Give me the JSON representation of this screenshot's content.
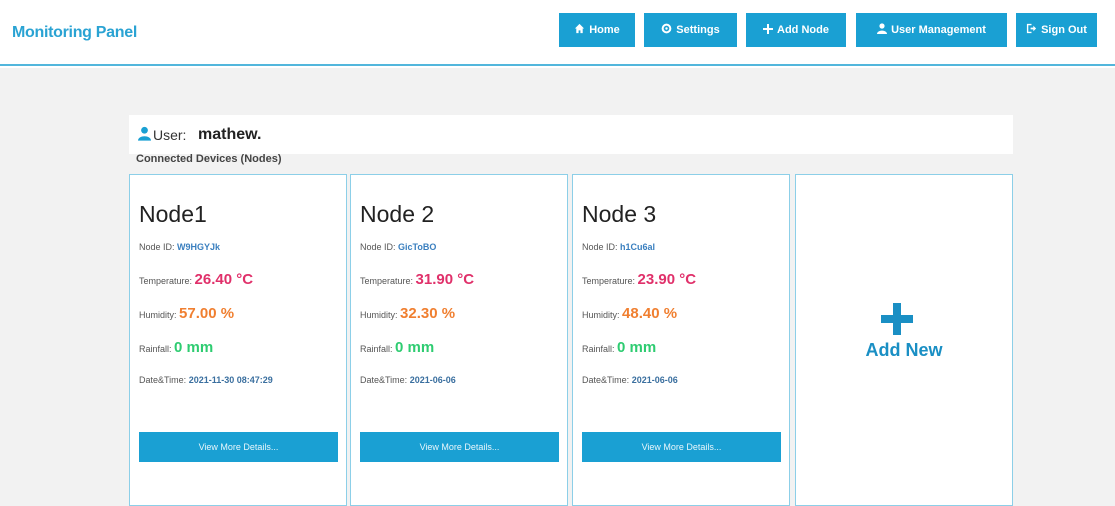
{
  "header": {
    "brand": "Monitoring Panel",
    "nav": [
      {
        "label": "Home",
        "icon": "home-icon"
      },
      {
        "label": "Settings",
        "icon": "gear-icon"
      },
      {
        "label": "Add Node",
        "icon": "plus-icon"
      },
      {
        "label": "User Management",
        "icon": "user-icon"
      },
      {
        "label": "Sign Out",
        "icon": "sign-out-icon"
      }
    ]
  },
  "user": {
    "label": "User:",
    "name": "mathew."
  },
  "section_title": "Connected Devices (Nodes)",
  "labels": {
    "node_id": "Node ID:",
    "temperature": "Temperature:",
    "humidity": "Humidity:",
    "rainfall": "Rainfall:",
    "datetime": "Date&Time:",
    "details_button": "View More Details..."
  },
  "nodes": [
    {
      "title": "Node1",
      "id": "W9HGYJk",
      "temperature": "26.40 °C",
      "humidity": "57.00 %",
      "rainfall": "0 mm",
      "datetime": "2021-11-30 08:47:29"
    },
    {
      "title": "Node 2",
      "id": "GicToBO",
      "temperature": "31.90 °C",
      "humidity": "32.30 %",
      "rainfall": "0 mm",
      "datetime": "2021-06-06"
    },
    {
      "title": "Node 3",
      "id": "h1Cu6al",
      "temperature": "23.90 °C",
      "humidity": "48.40 %",
      "rainfall": "0 mm",
      "datetime": "2021-06-06"
    }
  ],
  "add_card": {
    "label": "Add New"
  },
  "colors": {
    "accent": "#1aa0d3",
    "temperature": "#e0306a",
    "humidity": "#f07f30",
    "rainfall": "#2ecc71"
  }
}
